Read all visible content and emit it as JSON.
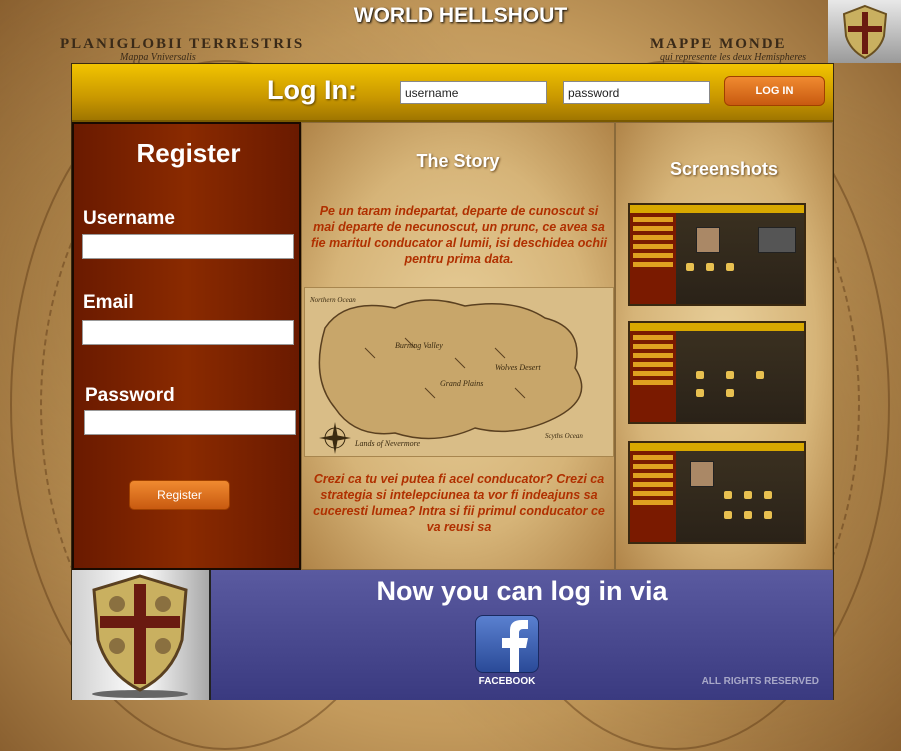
{
  "site": {
    "title": "WORLD HELLSHOUT"
  },
  "background_map": {
    "left_title": "PLANIGLOBII TERRESTRIS",
    "left_subtitle": "Mappa Vniversalis",
    "right_title": "MAPPE MONDE",
    "right_subtitle": "qui represente les deux Hemispheres"
  },
  "login": {
    "title": "Log In:",
    "username_value": "username",
    "password_value": "password",
    "button_label": "LOG IN"
  },
  "register": {
    "title": "Register",
    "username_label": "Username",
    "email_label": "Email",
    "password_label": "Password",
    "button_label": "Register"
  },
  "story": {
    "title": "The Story",
    "intro": "Pe un taram indepartat, departe de cunoscut si mai departe de necunoscut, un prunc, ce avea sa fie maritul conducator al lumii, isi deschidea ochii pentru prima data.",
    "outro": "Crezi ca tu vei putea fi acel conducator? Crezi ca strategia si intelepciunea ta vor fi indeajuns sa cuceresti lumea? Intra si fii primul conducator ce va reusi sa",
    "map_labels": {
      "lands": "Lands of Nevermore",
      "grand_plains": "Grand Plains",
      "burning_valley": "Burning Valley",
      "wolves_desert": "Wolves Desert",
      "northern_ocean": "Northern Ocean",
      "scyths_ocean": "Scyths Ocean"
    }
  },
  "screenshots": {
    "title": "Screenshots",
    "items": [
      {
        "name": "screenshot-1"
      },
      {
        "name": "screenshot-2"
      },
      {
        "name": "screenshot-3"
      }
    ]
  },
  "footer": {
    "headline": "Now you can log in via",
    "facebook_label": "FACEBOOK",
    "rights": "ALL RIGHTS RESERVED"
  },
  "colors": {
    "login_bar": "#e0b000",
    "register_panel": "#7a2200",
    "story_text": "#b03000",
    "footer_bg": "#4a4a90",
    "button_orange": "#e07020"
  }
}
